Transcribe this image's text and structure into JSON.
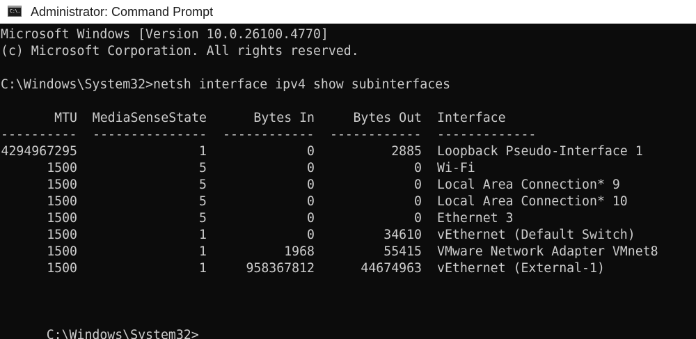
{
  "window": {
    "title": "Administrator: Command Prompt",
    "icon_label": "C:\\.",
    "icon": "cmd-icon"
  },
  "colors": {
    "console_bg": "#0c0c0c",
    "console_fg": "#cccccc",
    "titlebar_bg": "#ffffff"
  },
  "console": {
    "banner_line1": "Microsoft Windows [Version 10.0.26100.4770]",
    "banner_line2": "(c) Microsoft Corporation. All rights reserved.",
    "command_line": "C:\\Windows\\System32>netsh interface ipv4 show subinterfaces",
    "prompt": "C:\\Windows\\System32>",
    "table": {
      "headers": [
        "MTU",
        "MediaSenseState",
        "Bytes In",
        "Bytes Out",
        "Interface"
      ],
      "separators": [
        "----------",
        "---------------",
        "------------",
        "------------",
        "-------------"
      ],
      "rows": [
        [
          "4294967295",
          "1",
          "0",
          "2885",
          "Loopback Pseudo-Interface 1"
        ],
        [
          "1500",
          "5",
          "0",
          "0",
          "Wi-Fi"
        ],
        [
          "1500",
          "5",
          "0",
          "0",
          "Local Area Connection* 9"
        ],
        [
          "1500",
          "5",
          "0",
          "0",
          "Local Area Connection* 10"
        ],
        [
          "1500",
          "5",
          "0",
          "0",
          "Ethernet 3"
        ],
        [
          "1500",
          "1",
          "0",
          "34610",
          "vEthernet (Default Switch)"
        ],
        [
          "1500",
          "1",
          "1968",
          "55415",
          "VMware Network Adapter VMnet8"
        ],
        [
          "1500",
          "1",
          "958367812",
          "44674963",
          "vEthernet (External-1)"
        ]
      ]
    }
  }
}
